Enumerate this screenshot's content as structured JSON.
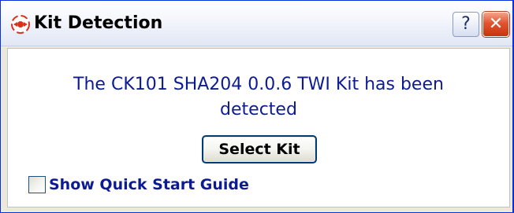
{
  "window": {
    "title": "Kit Detection",
    "help_glyph": "?",
    "close_glyph": "✕",
    "icons": {
      "app": "kit-detection-app-icon",
      "help": "help-icon",
      "close": "close-icon"
    }
  },
  "dialog": {
    "message": "The CK101 SHA204 0.0.6 TWI Kit has been detected",
    "select_kit_label": "Select Kit",
    "show_quick_start_label": "Show Quick Start Guide",
    "show_quick_start_checked": false
  },
  "colors": {
    "message_text": "#0d1b93",
    "close_button": "#e2542f",
    "window_frame": "#0831d9"
  }
}
